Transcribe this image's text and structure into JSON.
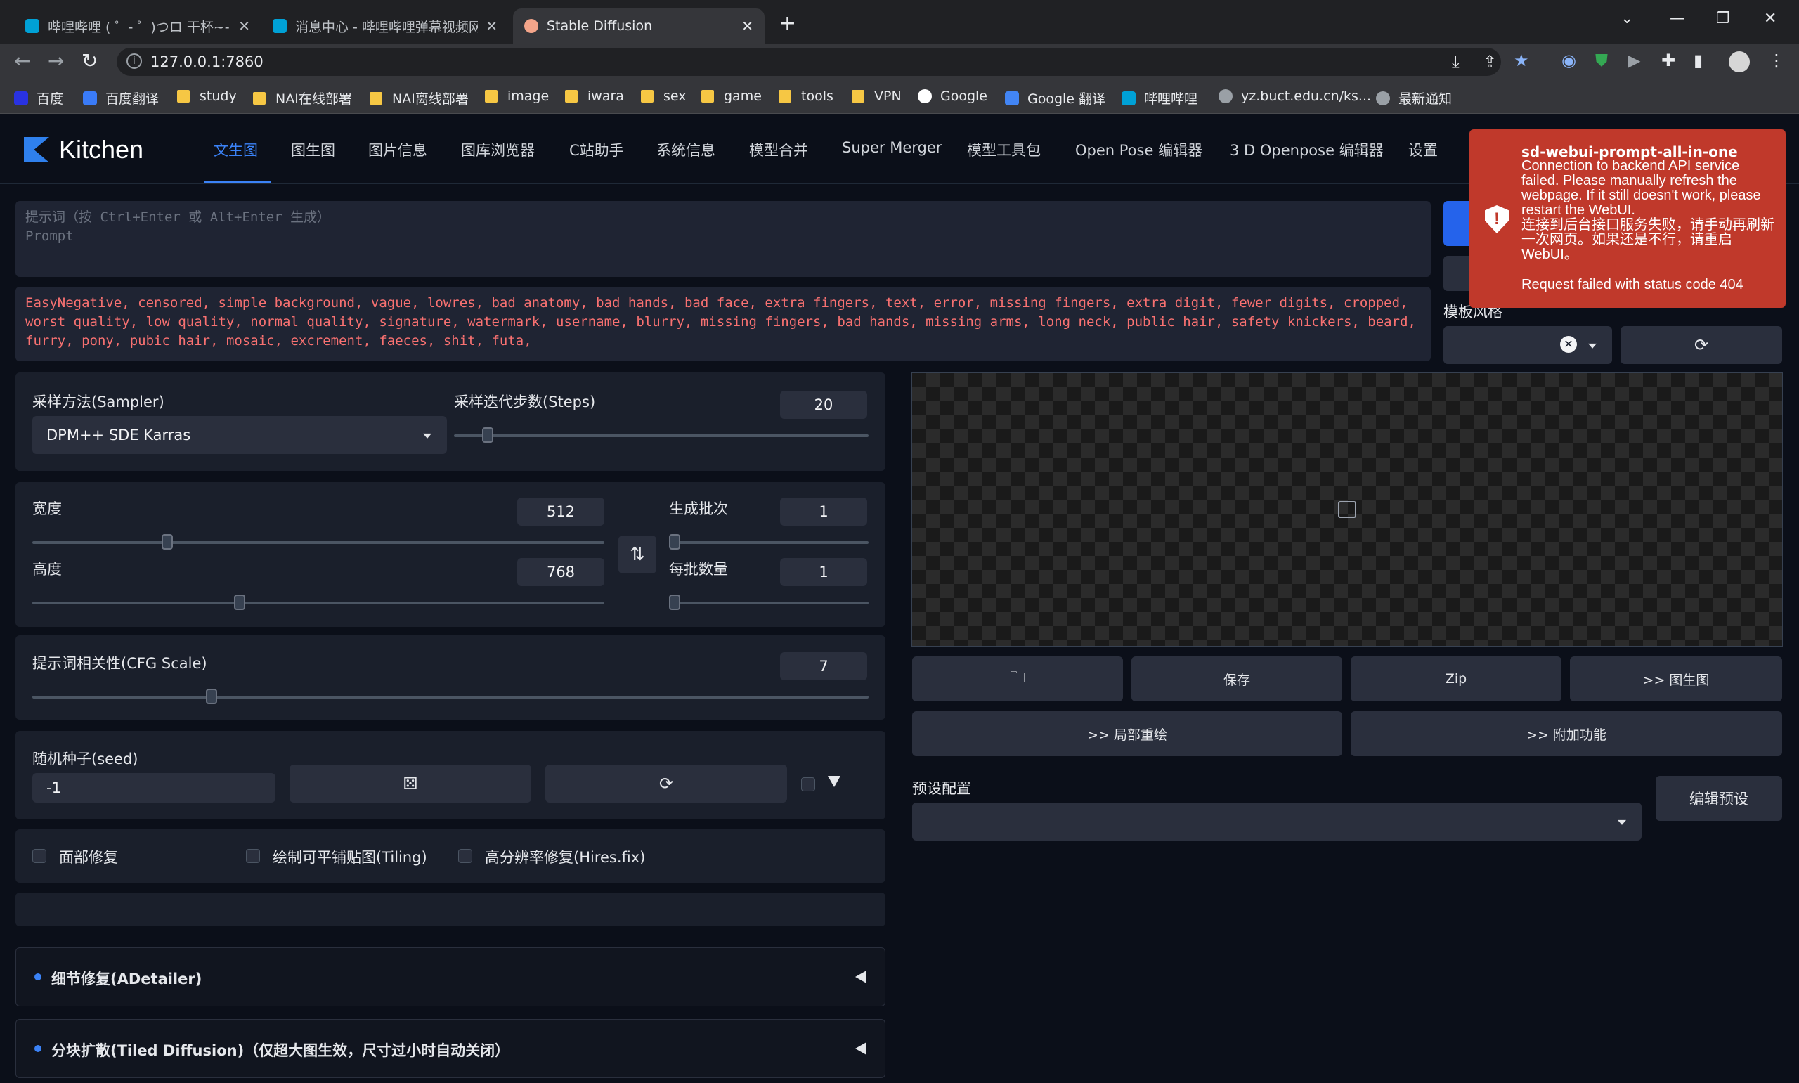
{
  "browser": {
    "tabs": [
      {
        "title": "哔哩哔哩 ( ゜- ゜)つロ 干杯~-bili",
        "active": false
      },
      {
        "title": "消息中心 - 哔哩哔哩弹幕视频网",
        "active": false
      },
      {
        "title": "Stable Diffusion",
        "active": true
      }
    ],
    "close_glyph": "✕",
    "new_tab_glyph": "+",
    "url": "127.0.0.1:7860",
    "bookmarks": [
      "百度",
      "百度翻译",
      "study",
      "NAI在线部署",
      "NAI离线部署",
      "image",
      "iwara",
      "sex",
      "game",
      "tools",
      "VPN",
      "Google",
      "Google 翻译",
      "哔哩哔哩",
      "yz.buct.edu.cn/ks...",
      "最新通知"
    ]
  },
  "app": {
    "logo": "Kitchen",
    "nav_tabs": [
      "文生图",
      "图生图",
      "图片信息",
      "图库浏览器",
      "C站助手",
      "系统信息",
      "模型合并",
      "Super Merger",
      "模型工具包",
      "Open Pose 编辑器",
      "3 D Openpose 编辑器",
      "设置"
    ],
    "active_tab": "文生图"
  },
  "prompt": {
    "placeholder_line1": "提示词（按 Ctrl+Enter 或 Alt+Enter 生成）",
    "placeholder_line2": "Prompt",
    "negative": "EasyNegative, censored, simple background, vague, lowres, bad anatomy, bad hands, bad face, extra fingers, text, error, missing fingers, extra digit, fewer digits, cropped, worst quality, low quality, normal quality, signature, watermark, username, blurry, missing fingers, bad hands, missing arms, long neck, public hair, safety knickers, beard, furry, pony, pubic hair, mosaic, excrement, faeces, shit, futa,"
  },
  "style_label": "模板风格",
  "sampler": {
    "label": "采样方法(Sampler)",
    "value": "DPM++ SDE Karras"
  },
  "steps": {
    "label": "采样迭代步数(Steps)",
    "value": "20",
    "level": 0.07
  },
  "width": {
    "label": "宽度",
    "value": "512",
    "level": 0.23
  },
  "height": {
    "label": "高度",
    "value": "768",
    "level": 0.36
  },
  "batch_count": {
    "label": "生成批次",
    "value": "1",
    "level": 0.0
  },
  "batch_size": {
    "label": "每批数量",
    "value": "1",
    "level": 0.0
  },
  "cfg": {
    "label": "提示词相关性(CFG Scale)",
    "value": "7",
    "level": 0.21
  },
  "seed": {
    "label": "随机种子(seed)",
    "value": "-1"
  },
  "options": {
    "face": "面部修复",
    "tiling": "绘制可平铺贴图(Tiling)",
    "hires": "高分辨率修复(Hires.fix)"
  },
  "output_buttons": {
    "save": "保存",
    "zip": "Zip",
    "to_img2img": ">> 图生图",
    "to_inpaint": ">> 局部重绘",
    "to_extras": ">> 附加功能"
  },
  "preset": {
    "label": "预设配置",
    "edit": "编辑预设"
  },
  "accordions": [
    "细节修复(ADetailer)",
    "分块扩散(Tiled Diffusion)（仅超大图生效，尺寸过小时自动关闭）"
  ],
  "toast": {
    "title": "sd-webui-prompt-all-in-one",
    "message_en": "Connection to backend API service failed. Please manually refresh the webpage. If it still doesn't work, please restart the WebUI.",
    "message_zh": "连接到后台接口服务失败，请手动再刷新一次网页。如果还是不行，请重启WebUI。",
    "status": "Request failed with status code 404"
  },
  "colors": {
    "accent": "#3b82f6",
    "toast": "#c0392b",
    "background": "#0b0f19"
  }
}
